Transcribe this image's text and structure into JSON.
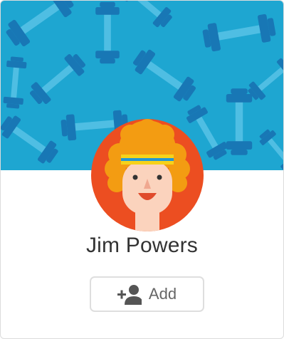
{
  "profile": {
    "name": "Jim Powers",
    "cover_icon": "dumbbell-pattern",
    "avatar_icon": "curly-hair-headband-avatar"
  },
  "actions": {
    "add_label": "Add",
    "add_icon": "add-person-icon"
  },
  "colors": {
    "cover_bg": "#1ea6d1",
    "dumbbell_dark": "#1877b5",
    "dumbbell_light": "#4fbee3",
    "avatar_bg": "#ec4e21",
    "hair": "#f39c12",
    "skin": "#fbd3bd",
    "headband_yellow": "#f6d21a",
    "headband_blue": "#2596d1",
    "button_icon": "#555555",
    "button_text": "#666666"
  }
}
